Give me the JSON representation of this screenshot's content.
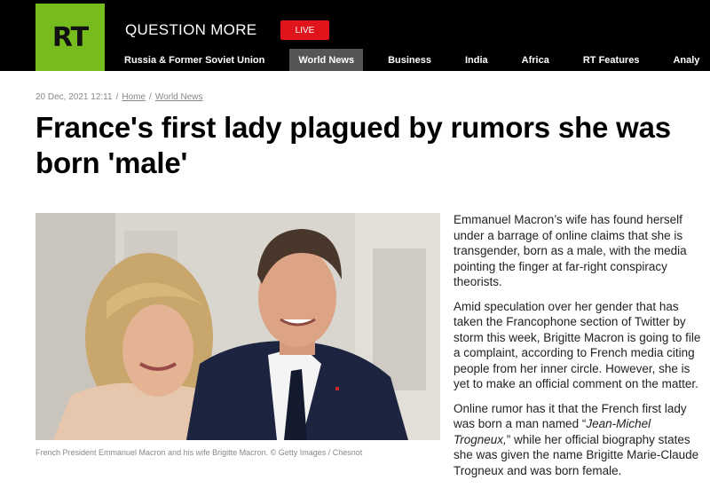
{
  "header": {
    "logo_text": "RT",
    "tagline": "QUESTION MORE",
    "live_label": "LIVE",
    "nav": [
      {
        "label": "Russia & Former Soviet Union",
        "active": false
      },
      {
        "label": "World News",
        "active": true
      },
      {
        "label": "Business",
        "active": false
      },
      {
        "label": "India",
        "active": false
      },
      {
        "label": "Africa",
        "active": false
      },
      {
        "label": "RT Features",
        "active": false
      },
      {
        "label": "Analy",
        "active": false
      }
    ],
    "colors": {
      "logo_bg": "#77bc1f",
      "live_bg": "#e0141b",
      "nav_active_bg": "#555555"
    }
  },
  "article": {
    "date": "20 Dec, 2021 12:11",
    "breadcrumb": [
      "Home",
      "World News"
    ],
    "headline": "France's first lady plagued by rumors she was born 'male'",
    "caption": "French President Emmanuel Macron and his wife Brigitte Macron. © Getty Images / Chesnot",
    "p1": "Emmanuel Macron’s wife has found herself under a barrage of online claims that she is transgender, born as a male, with the media pointing the finger at far-right conspiracy theorists.",
    "p2": "Amid speculation over her gender that has taken the Francophone section of Twitter by storm this week, Brigitte Macron is going to file a complaint, according to French media citing people from her inner circle. However, she is yet to make an official comment on the matter.",
    "p3_before": "Online rumor has it that the French first lady was born a man named “",
    "p3_italic": "Jean-Michel Trogneux,",
    "p3_after": "” while her official biography states she was given the name Brigitte Marie-Claude Trogneux and was born female."
  }
}
